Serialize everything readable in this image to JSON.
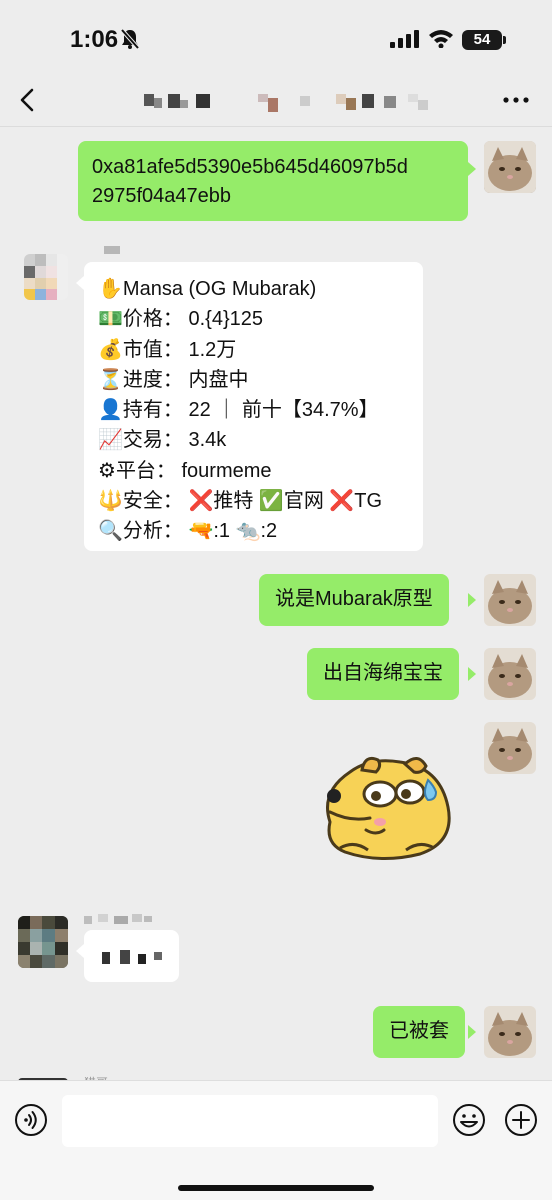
{
  "status": {
    "time": "1:06",
    "battery": "54"
  },
  "chat": {
    "messages": [
      {
        "line1": "0xa81afe5d5390e5b645d46097b5d",
        "line2": "2975f04a47ebb"
      },
      {
        "lines": [
          {
            "emoji": "✋",
            "text": "Mansa (OG Mubarak)"
          },
          {
            "emoji": "💵",
            "text": "价格：  0.{4}125"
          },
          {
            "emoji": "💰",
            "text": "市值：  1.2万"
          },
          {
            "emoji": "⏳",
            "text": "进度：  内盘中"
          },
          {
            "emoji": "👤",
            "text": "持有：  22 ｜ 前十【34.7%】"
          },
          {
            "emoji": "📈",
            "text": "交易：  3.4k"
          },
          {
            "emoji": "⚙",
            "text": "平台：  fourmeme"
          },
          {
            "emoji": "🔱",
            "text": "安全：  ❌推特 ✅官网 ❌TG"
          },
          {
            "emoji": "🔍",
            "text": "分析：  🔫:1 🐀:2"
          }
        ]
      },
      {
        "text": "说是Mubarak原型"
      },
      {
        "text": "出自海绵宝宝"
      },
      {
        "text": "已被套"
      }
    ],
    "partial_sender": "猎哥"
  },
  "icons": {
    "back": "chevron-left-icon",
    "more": "more-dots-icon",
    "voice": "voice-icon",
    "emoji": "emoji-face-icon",
    "plus": "plus-circle-icon"
  },
  "colors": {
    "sent_bubble": "#95ec69",
    "received_bubble": "#ffffff",
    "background": "#ededed"
  }
}
